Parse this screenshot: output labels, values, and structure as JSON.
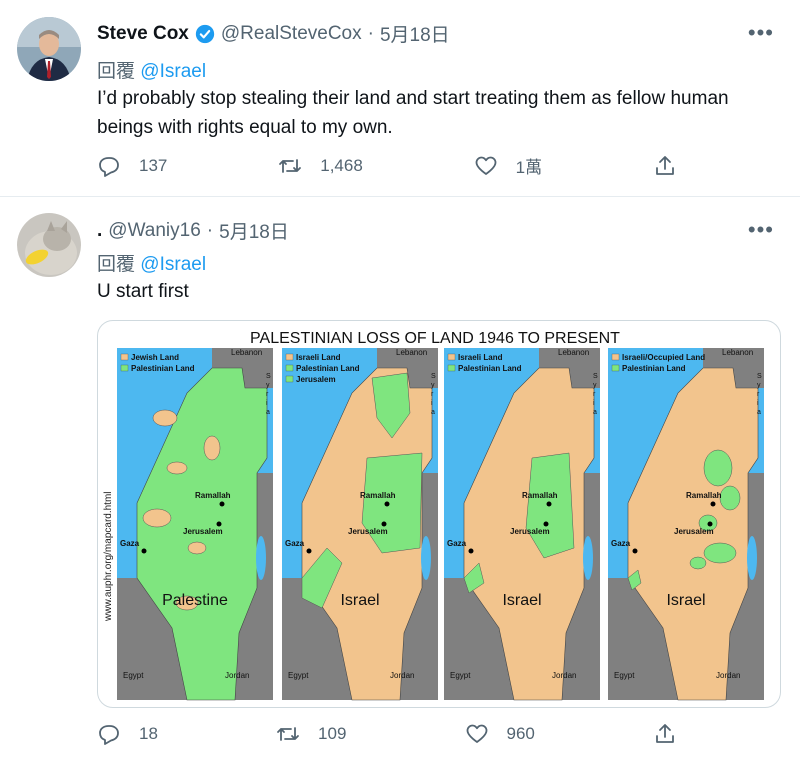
{
  "tweet1": {
    "display_name": "Steve Cox",
    "handle": "@RealSteveCox",
    "separator": "·",
    "date": "5月18日",
    "more": "•••",
    "reply_prefix": "回覆",
    "reply_to": "@Israel",
    "text": "I’d probably stop stealing their land and start treating them as fellow human beings with rights equal to my own.",
    "replies": "137",
    "retweets": "1,468",
    "likes": "1萬"
  },
  "tweet2": {
    "display_name": ".",
    "handle": "@Waniy16",
    "separator": "·",
    "date": "5月18日",
    "more": "•••",
    "reply_prefix": "回覆",
    "reply_to": "@Israel",
    "text": "U start first",
    "replies": "18",
    "retweets": "109",
    "likes": "960"
  },
  "image": {
    "title": "PALESTINIAN LOSS OF LAND 1946 TO PRESENT",
    "source": "www.auphr.org/mapcard.html",
    "maps": [
      {
        "legend": [
          "Jewish Land",
          "Palestinian Land"
        ],
        "big_label": "Palestine",
        "places": [
          "Ramallah",
          "Jerusalem",
          "Gaza",
          "Egypt",
          "Jordan",
          "Lebanon"
        ]
      },
      {
        "legend": [
          "Israeli Land",
          "Palestinian Land",
          "Jerusalem"
        ],
        "big_label": "Israel",
        "places": [
          "Ramallah",
          "Jerusalem",
          "Gaza",
          "Egypt",
          "Jordan",
          "Lebanon"
        ]
      },
      {
        "legend": [
          "Israeli Land",
          "Palestinian Land"
        ],
        "big_label": "Israel",
        "places": [
          "Ramallah",
          "Jerusalem",
          "Gaza",
          "Egypt",
          "Jordan",
          "Lebanon"
        ]
      },
      {
        "legend": [
          "Israeli/Occupied Land",
          "Palestinian Land"
        ],
        "big_label": "Israel",
        "places": [
          "Ramallah",
          "Jerusalem",
          "Gaza",
          "Egypt",
          "Jordan",
          "Lebanon"
        ]
      }
    ],
    "syria": [
      "S",
      "y",
      "r",
      "i",
      "a"
    ],
    "colors": {
      "sea": "#4db8f0",
      "green": "#7fe57f",
      "tan": "#f2c48d",
      "gray": "#808080"
    }
  }
}
